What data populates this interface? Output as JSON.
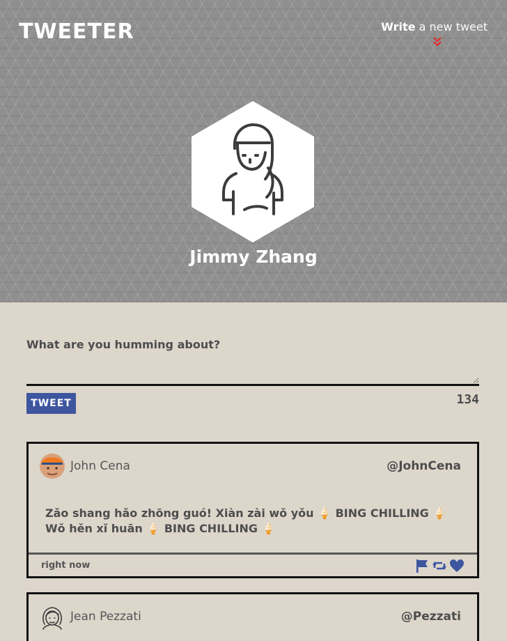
{
  "header": {
    "logo": "TWEETER",
    "compose_toggle": {
      "strong": "Write",
      "rest": " a new tweet"
    }
  },
  "profile": {
    "name": "Jimmy Zhang",
    "avatar_icon": "user-avatar-icon"
  },
  "compose": {
    "label": "What are you humming about?",
    "textarea_value": "",
    "button_label": "TWEET",
    "char_count": "134"
  },
  "tweets": [
    {
      "name": "John Cena",
      "handle": "@JohnCena",
      "body": "Zǎo shang hǎo zhōng guó! Xiàn zài wǒ yǒu 🍦 BING CHILLING 🍦 Wǒ hěn xǐ huān 🍦 BING CHILLING 🍦",
      "time": "right now",
      "avatar_icon": "john-cena-avatar-icon",
      "actions": [
        "flag-icon",
        "retweet-icon",
        "heart-icon"
      ]
    },
    {
      "name": "Jean Pezzati",
      "handle": "@Pezzati",
      "avatar_icon": "girl-avatar-icon"
    }
  ],
  "colors": {
    "header_bg": "#8f8f8f",
    "page_bg": "#ddd6cb",
    "accent_blue": "#3e56a0",
    "chevron_red": "#e02828",
    "text_dark": "#4d4d4d"
  }
}
